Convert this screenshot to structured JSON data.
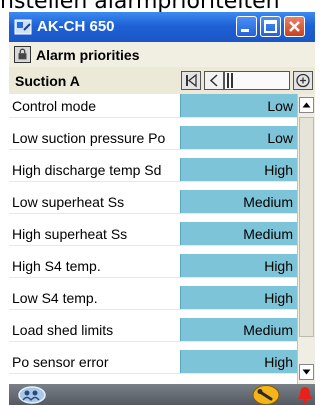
{
  "caption": "nstellen alarmprioriteiten",
  "window": {
    "title": "AK-CH 650"
  },
  "screen": {
    "title": "Alarm priorities"
  },
  "section": {
    "title": "Suction A"
  },
  "rows": [
    {
      "label": "Control mode",
      "value": "Low"
    },
    {
      "label": "Low suction pressure Po",
      "value": "Low"
    },
    {
      "label": "High discharge temp Sd",
      "value": "High"
    },
    {
      "label": "Low superheat Ss",
      "value": "Medium"
    },
    {
      "label": "High superheat Ss",
      "value": "Medium"
    },
    {
      "label": "High S4 temp.",
      "value": "High"
    },
    {
      "label": "Low S4 temp.",
      "value": "High"
    },
    {
      "label": "Load shed limits",
      "value": "Medium"
    },
    {
      "label": "Po sensor error",
      "value": "High"
    }
  ],
  "colors": {
    "titlebar": "#1f62d6",
    "value_cell": "#7ec4d8",
    "bottom_bar": "#5c6169",
    "alarm": "#e8221a",
    "wrench_button": "#f4b41a"
  },
  "icons": {
    "window": "controller-icon",
    "screen": "lock-icon",
    "bottom_left": "users-icon",
    "bottom_middle": "wrench-icon",
    "bottom_right": "alarm-bell-icon"
  }
}
